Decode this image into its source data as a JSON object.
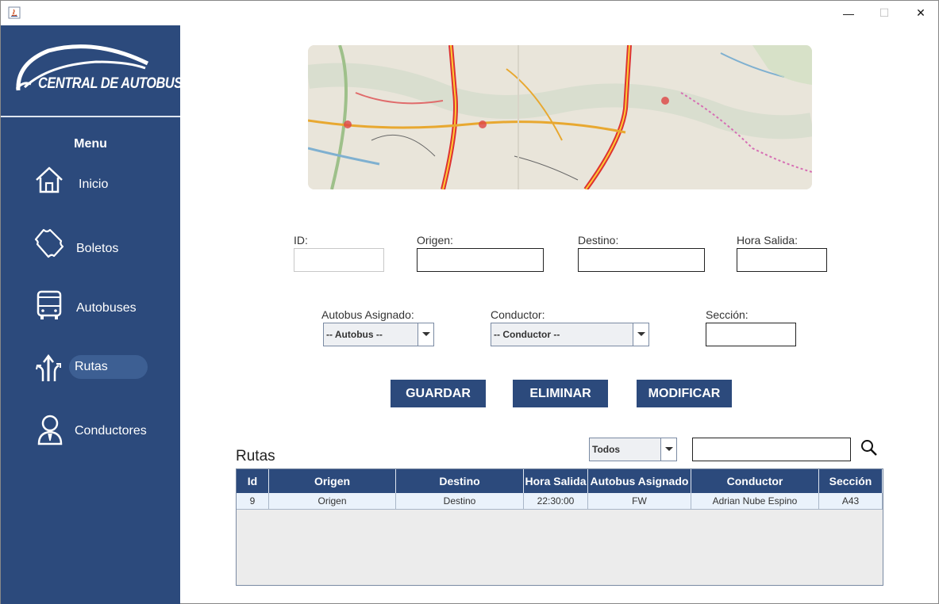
{
  "window": {
    "min": "—",
    "max": "☐",
    "close": "✕"
  },
  "sidebar": {
    "logo_text": "CENTRAL DE AUTOBUSES",
    "menu_title": "Menu",
    "items": [
      {
        "label": "Inicio",
        "icon": "home-icon"
      },
      {
        "label": "Boletos",
        "icon": "ticket-icon"
      },
      {
        "label": "Autobuses",
        "icon": "bus-icon"
      },
      {
        "label": "Rutas",
        "icon": "routes-icon",
        "active": true
      },
      {
        "label": "Conductores",
        "icon": "driver-icon"
      }
    ],
    "color": "#2c4a7c"
  },
  "form": {
    "id_label": "ID:",
    "id_value": "",
    "origen_label": "Origen:",
    "origen_value": "",
    "destino_label": "Destino:",
    "destino_value": "",
    "hora_label": "Hora Salida:",
    "hora_value": "",
    "autobus_label": "Autobus Asignado:",
    "autobus_selected": "-- Autobus --",
    "conductor_label": "Conductor:",
    "conductor_selected": "-- Conductor --",
    "seccion_label": "Sección:",
    "seccion_value": ""
  },
  "buttons": {
    "guardar": "GUARDAR",
    "eliminar": "ELIMINAR",
    "modificar": "MODIFICAR"
  },
  "table_section": {
    "title": "Rutas",
    "filter_selected": "Todos",
    "search_value": ""
  },
  "table": {
    "headers": [
      "Id",
      "Origen",
      "Destino",
      "Hora Salida",
      "Autobus Asignado",
      "Conductor",
      "Sección"
    ],
    "rows": [
      [
        "9",
        "Origen",
        "Destino",
        "22:30:00",
        "FW",
        "Adrian Nube Espino",
        "A43"
      ]
    ]
  }
}
